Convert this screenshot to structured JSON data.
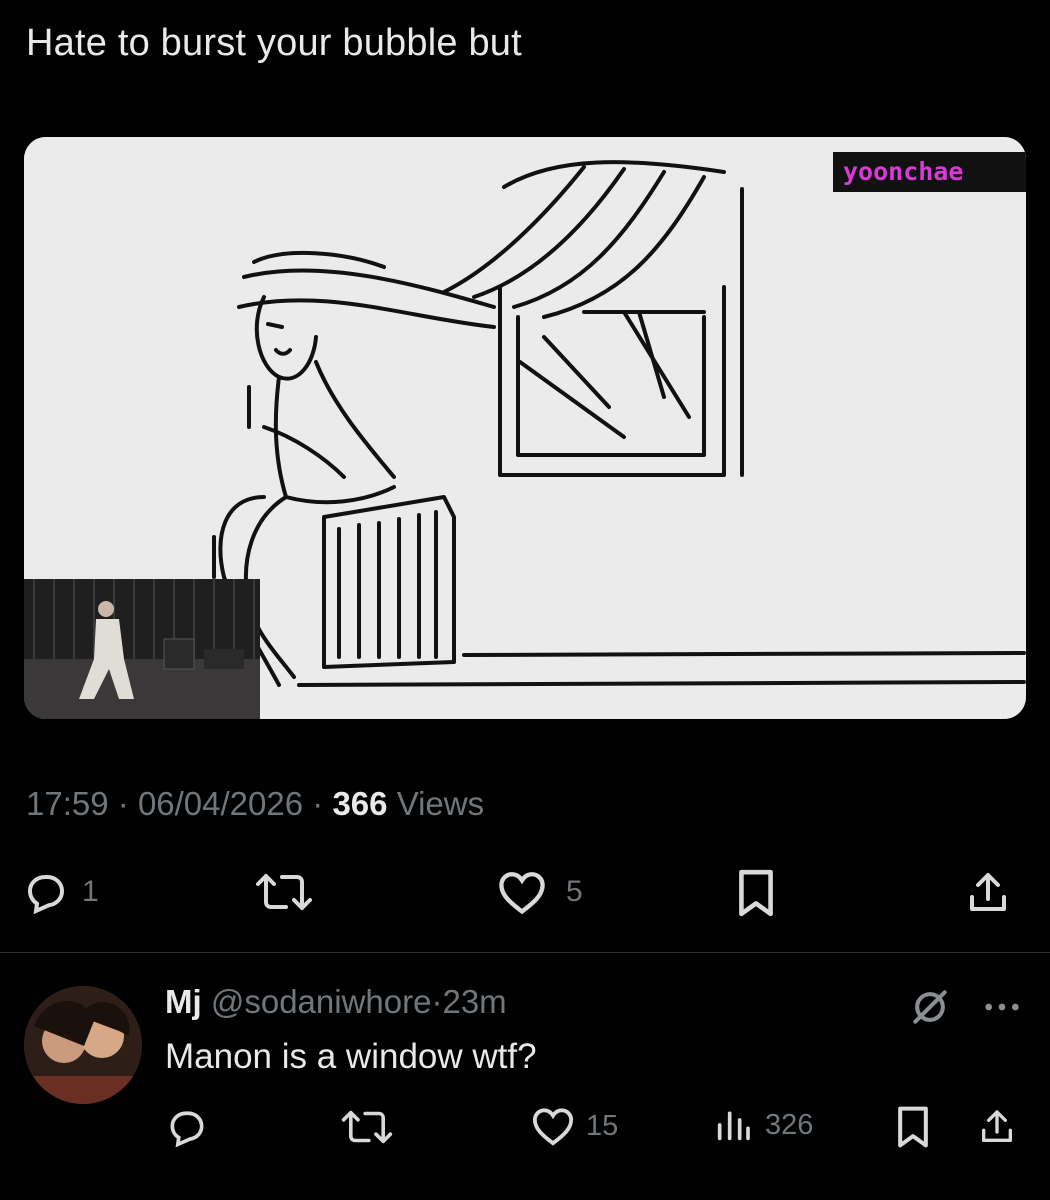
{
  "tweet": {
    "text": "Hate to burst your bubble but",
    "media": {
      "watermark": "yoonchae"
    },
    "time": "17:59",
    "date": "06/04/2026",
    "views_count": "366",
    "views_label": "Views",
    "sep": "·",
    "actions": {
      "replies": "1",
      "likes": "5"
    }
  },
  "reply": {
    "name": "Mj",
    "handle": "@sodaniwhore",
    "sep": "·",
    "time": "23m",
    "text": "Manon is a window wtf?",
    "actions": {
      "likes": "15",
      "views": "326"
    }
  },
  "icons": {
    "reply": "reply-icon",
    "retweet": "retweet-icon",
    "like": "heart-icon",
    "bookmark": "bookmark-icon",
    "share": "share-icon",
    "views": "analytics-icon",
    "grok": "grok-icon",
    "more": "more-icon"
  },
  "colors": {
    "background": "#000000",
    "text": "#e7e9ea",
    "secondary": "#71767b",
    "divider": "#2f3336",
    "watermark": "#d63bd8"
  }
}
